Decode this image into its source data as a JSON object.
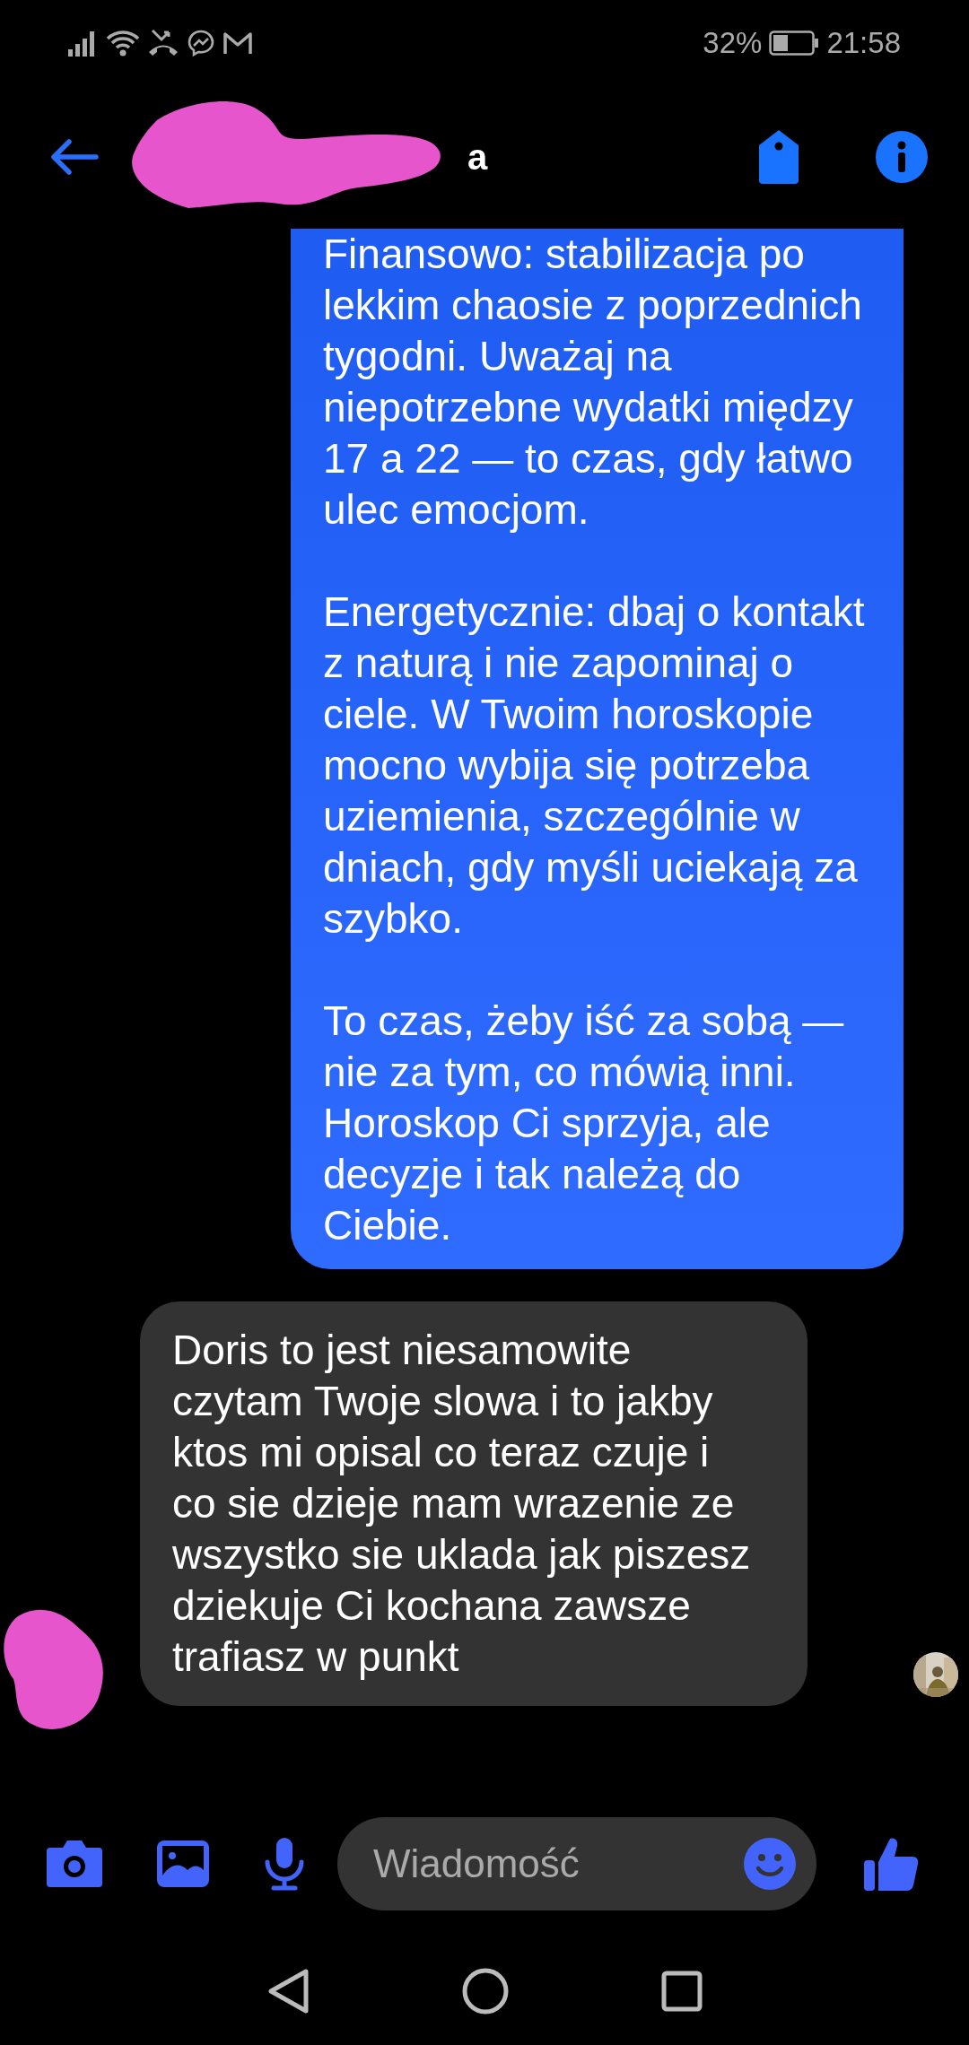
{
  "status_bar": {
    "battery": "32%",
    "time": "21:58"
  },
  "header": {
    "title": "a"
  },
  "messages": [
    {
      "kind": "outgoing",
      "paragraphs": [
        "Finansowo: stabilizacja po lekkim chaosie z poprzednich tygodni. Uważaj na niepotrzebne wydatki między 17 a 22 — to czas, gdy łatwo ulec emocjom.",
        "Energetycznie: dbaj o kontakt z naturą i nie zapominaj o ciele. W Twoim horoskopie mocno wybija się potrzeba uziemienia, szczególnie w dniach, gdy myśli uciekają za szybko.",
        "To czas, żeby iść za sobą — nie za tym, co mówią inni. Horoskop Ci sprzyja, ale decyzje i tak należą do Ciebie."
      ]
    },
    {
      "kind": "incoming",
      "paragraphs": [
        "Doris to jest niesamowite czytam Twoje slowa i to jakby ktos mi opisal co teraz czuje i co sie dzieje mam wrazenie ze wszystko sie uklada jak piszesz dziekuje Ci kochana zawsze trafiasz w punkt"
      ]
    }
  ],
  "composer": {
    "placeholder": "Wiadomość"
  }
}
